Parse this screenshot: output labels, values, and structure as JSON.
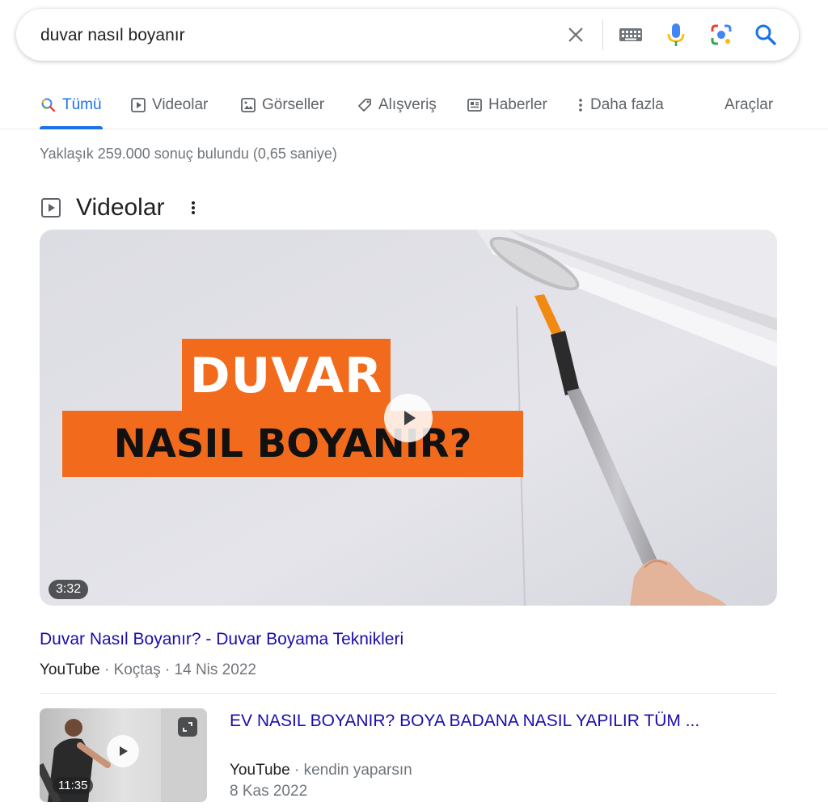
{
  "search": {
    "query": "duvar nasıl boyanır"
  },
  "tabs": [
    {
      "label": "Tümü",
      "icon": "search-icon",
      "active": true
    },
    {
      "label": "Videolar",
      "icon": "play-icon"
    },
    {
      "label": "Görseller",
      "icon": "image-icon"
    },
    {
      "label": "Alışveriş",
      "icon": "tag-icon"
    },
    {
      "label": "Haberler",
      "icon": "news-icon"
    },
    {
      "label": "Daha fazla",
      "icon": "more-vert-icon"
    }
  ],
  "tools_label": "Araçlar",
  "result_stats": "Yaklaşık 259.000 sonuç bulundu (0,65 saniye)",
  "videos_section": {
    "title": "Videolar",
    "featured": {
      "thumbnail_text_line1": "DUVAR",
      "thumbnail_text_line2": "NASIL BOYANIR?",
      "duration": "3:32",
      "title": "Duvar Nasıl Boyanır? - Duvar Boyama Teknikleri",
      "source": "YouTube",
      "channel": "Koçtaş",
      "date": "14 Nis 2022",
      "separator": "·"
    },
    "items": [
      {
        "duration": "11:35",
        "title": "EV NASIL BOYANIR? BOYA BADANA NASIL YAPILIR TÜM ...",
        "source": "YouTube",
        "channel": "kendin yaparsın",
        "date": "8 Kas 2022",
        "separator": "·"
      }
    ]
  },
  "colors": {
    "accent": "#1a73e8",
    "link": "#1a0dab",
    "thumbnail_orange": "#f26b1d"
  }
}
